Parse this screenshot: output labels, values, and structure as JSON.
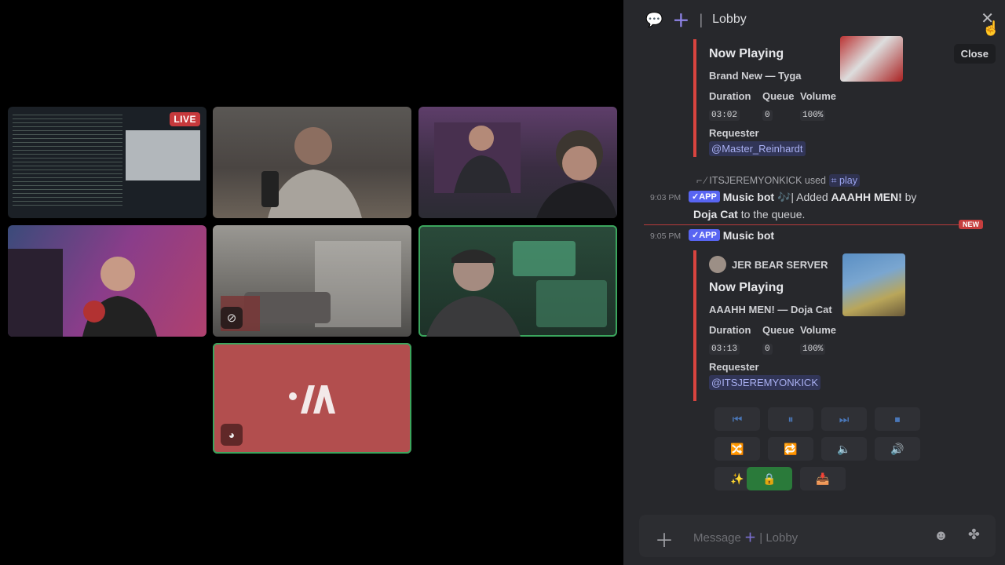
{
  "video": {
    "tiles": [
      {
        "id": "screen-share",
        "live": "LIVE"
      },
      {
        "id": "cam-2"
      },
      {
        "id": "cam-3"
      },
      {
        "id": "cam-4"
      },
      {
        "id": "cam-5",
        "muted": true
      },
      {
        "id": "cam-6",
        "speaking": true
      },
      {
        "id": "avatar-7",
        "speaking": true,
        "logo": "M"
      }
    ]
  },
  "chat": {
    "header": {
      "channel_sep": "|",
      "channel": "Lobby"
    },
    "close_tooltip": "Close",
    "embed1": {
      "title": "Now Playing",
      "song": "Brand New — Tyga",
      "labels": [
        "Duration",
        "Queue",
        "Volume"
      ],
      "values": [
        "03:02",
        "0",
        "100%"
      ],
      "requester_label": "Requester",
      "requester": "@Master_Reinhardt"
    },
    "command": {
      "user": "ITSJEREMYONKICK",
      "used": "used",
      "command": "play"
    },
    "msg1": {
      "time": "9:03 PM",
      "badge": "✓APP",
      "author": "Music bot",
      "text_pre": "🎶| Added",
      "song": "AAAHH MEN!",
      "by": "by",
      "artist": "Doja Cat",
      "text_post": "to the queue."
    },
    "new_label": "NEW",
    "msg2": {
      "time": "9:05 PM",
      "badge": "✓APP",
      "author": "Music bot"
    },
    "embed2": {
      "server": "JER BEAR SERVER",
      "title": "Now Playing",
      "song": "AAAHH MEN! — Doja Cat",
      "labels": [
        "Duration",
        "Queue",
        "Volume"
      ],
      "values": [
        "03:13",
        "0",
        "100%"
      ],
      "requester_label": "Requester",
      "requester": "@ITSJEREMYONKICK"
    },
    "composer": {
      "placeholder": "Message",
      "sep": "|",
      "channel": "Lobby"
    }
  }
}
